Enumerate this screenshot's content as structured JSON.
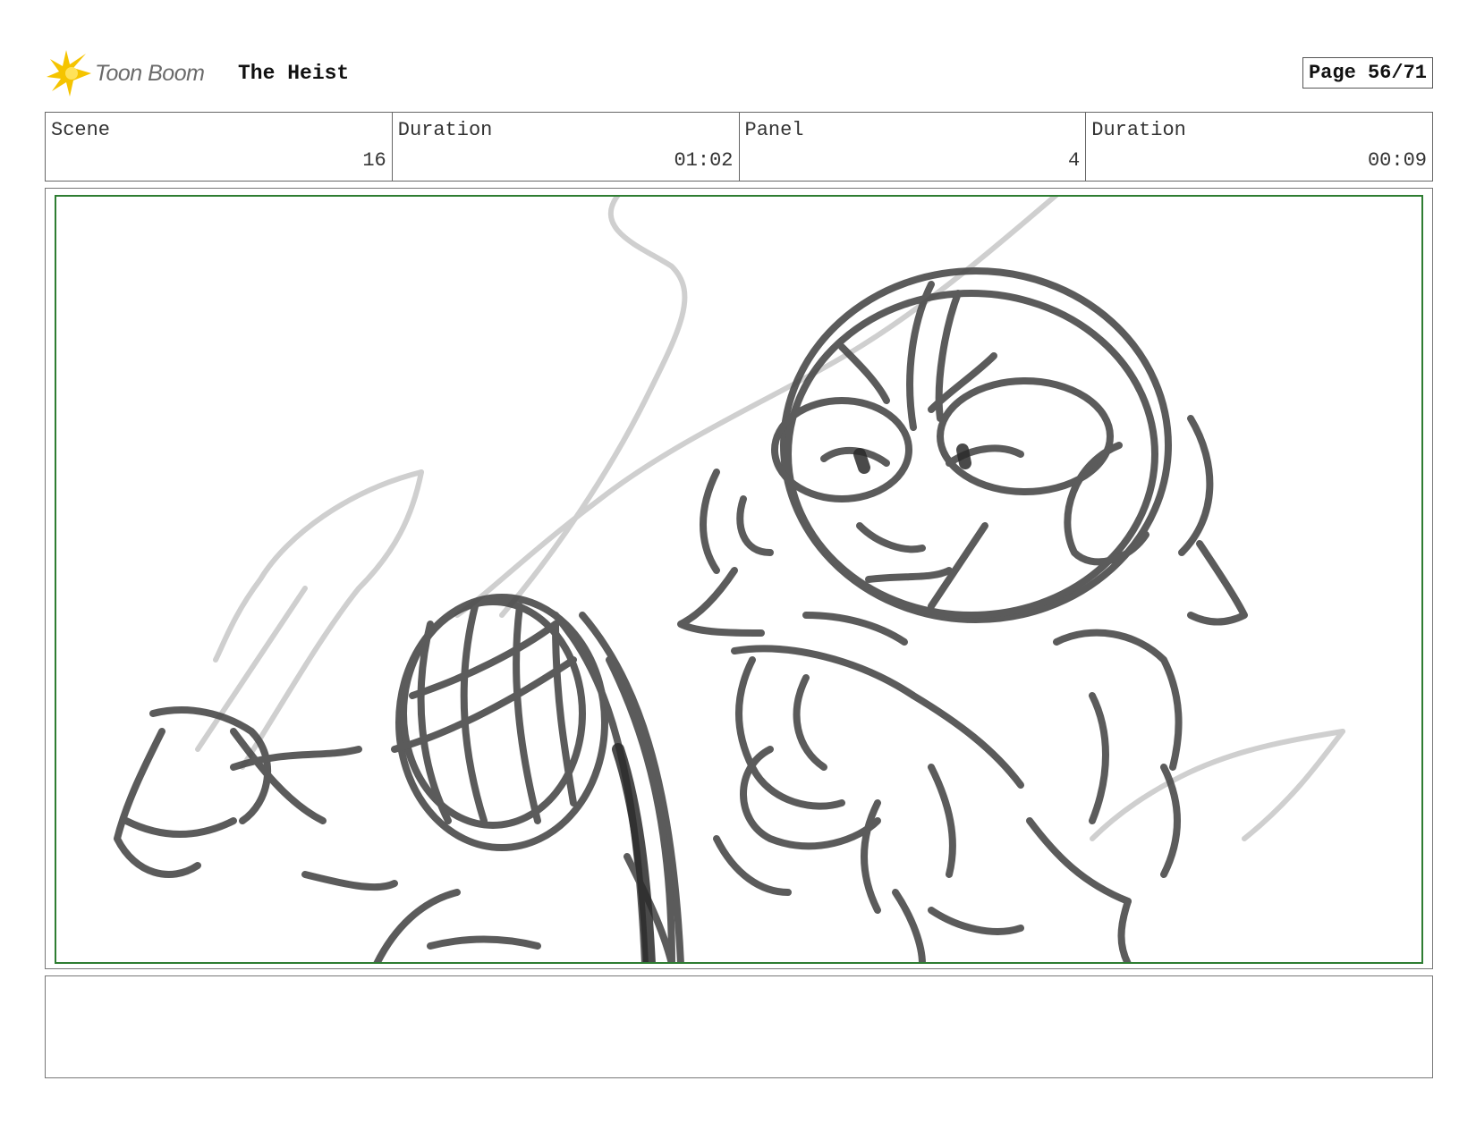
{
  "header": {
    "logo_text": "Toon Boom",
    "project_title": "The Heist",
    "page_label": "Page 56/71"
  },
  "info": {
    "scene_label": "Scene",
    "scene_value": "16",
    "scene_duration_label": "Duration",
    "scene_duration_value": "01:02",
    "panel_label": "Panel",
    "panel_value": "4",
    "panel_duration_label": "Duration",
    "panel_duration_value": "00:09"
  },
  "panel": {
    "frame_color": "#2e7d32",
    "sketch_color": "#4a4a4a",
    "guide_color": "#cfcfcf"
  },
  "notes": {
    "text": ""
  }
}
